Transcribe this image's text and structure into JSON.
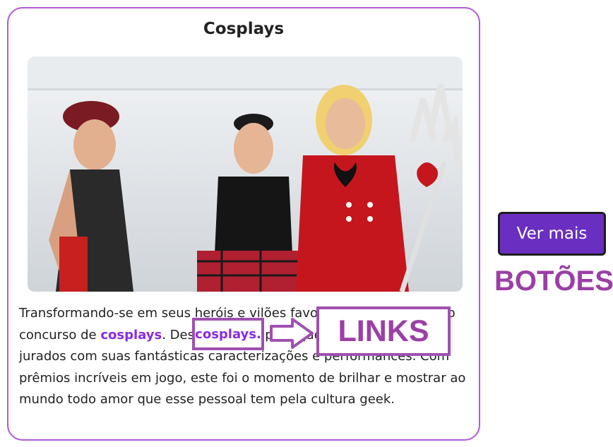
{
  "card": {
    "title": "Cosplays",
    "text_before_link": "Transformando-se em seus heróis e vilões favoritos, participaram do concurso de ",
    "link_text": "cosplays",
    "text_after_link": ". Desafiando-se para que impressione os jurados com suas fantásticas caracterizações e performances. Com prêmios incríveis em jogo, este foi o momento de brilhar e mostrar ao mundo todo amor que esse pessoal tem pela cultura geek."
  },
  "annotations": {
    "highlighted_link": "cosplays.",
    "links_label": "LINKS",
    "botoes_label": "BOTÕES"
  },
  "button": {
    "label": "Ver mais"
  },
  "colors": {
    "accent_purple": "#8a2be2",
    "border_purple": "#b05ad9",
    "annotation_purple": "#9b3fa6",
    "button_bg": "#6a2fc0"
  },
  "icons": {
    "arrow": "right-arrow-icon"
  }
}
